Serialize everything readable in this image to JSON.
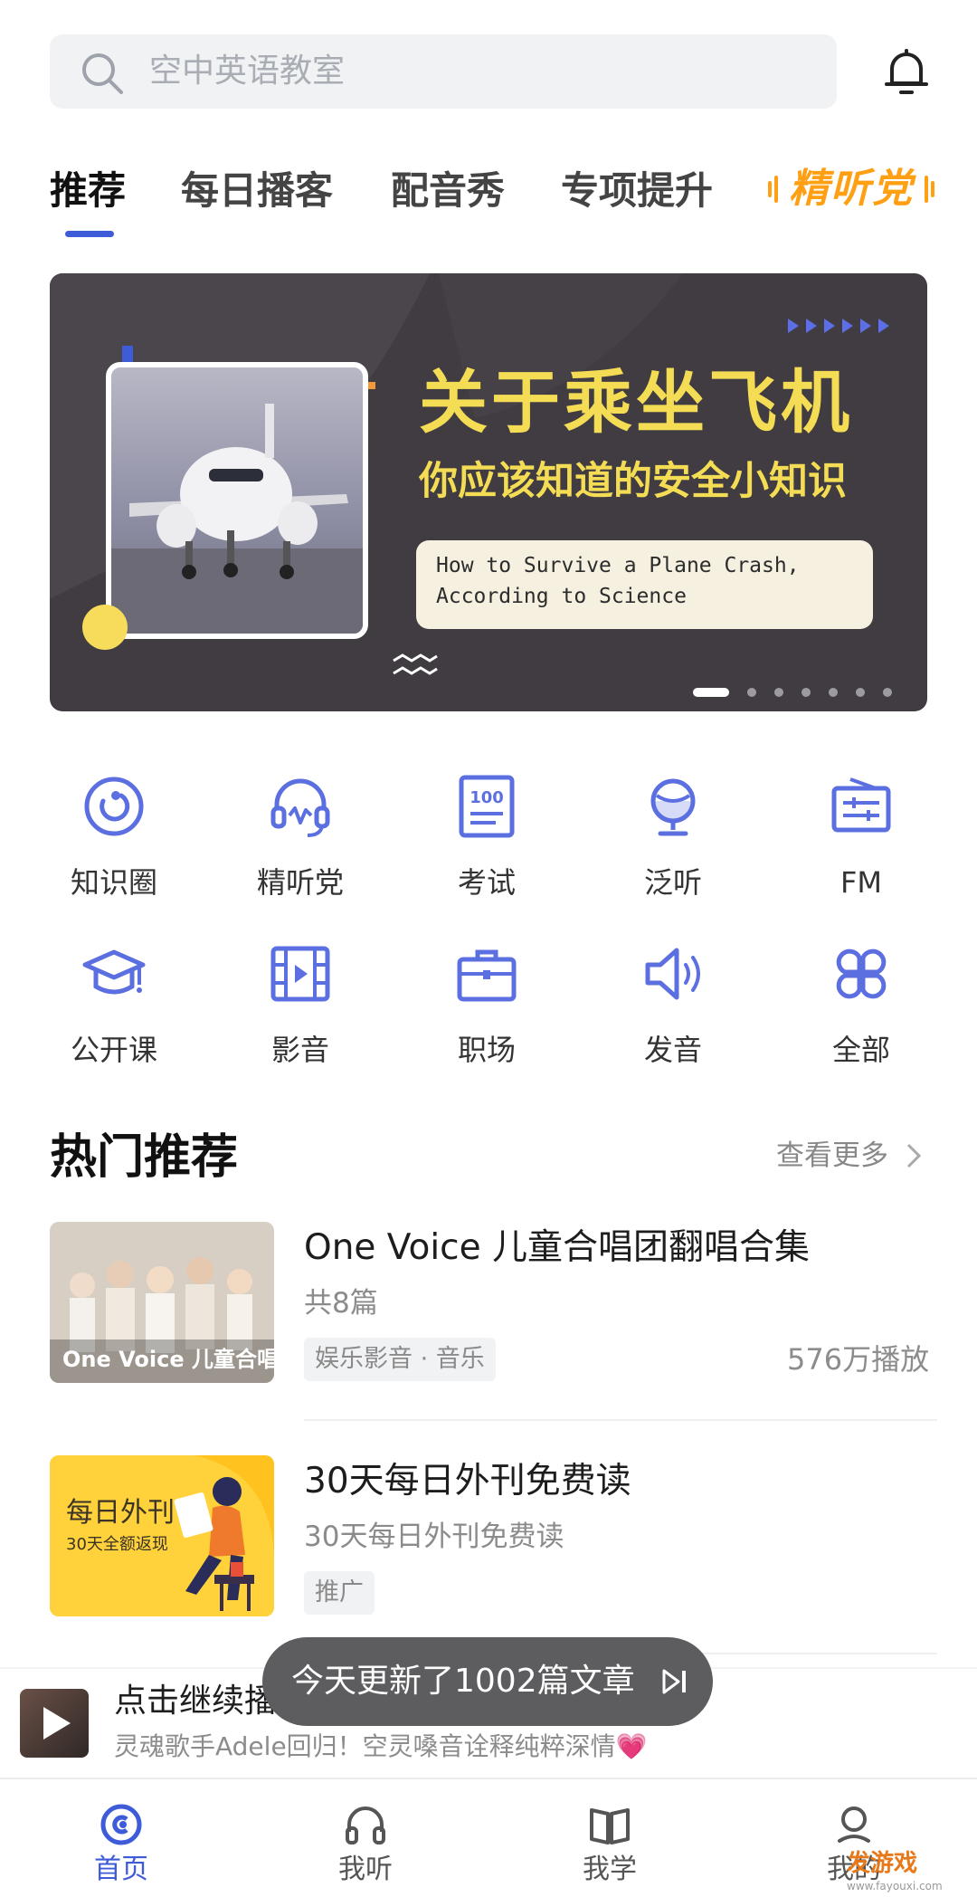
{
  "colors": {
    "accent": "#3e5bd8",
    "icon": "#5b6fe0",
    "banner_bg": "#403c42",
    "banner_title": "#f4dd54",
    "special_tab": "#ff9f14"
  },
  "search": {
    "placeholder": "空中英语教室",
    "icon": "search-icon",
    "bell_icon": "bell-icon"
  },
  "tabs": [
    {
      "label": "推荐",
      "active": true
    },
    {
      "label": "每日播客",
      "active": false
    },
    {
      "label": "配音秀",
      "active": false
    },
    {
      "label": "专项提升",
      "active": false
    },
    {
      "label": "精听党",
      "active": false
    }
  ],
  "banner": {
    "title": "关于乘坐飞机",
    "subtitle": "你应该知道的安全小知识",
    "card_line1": "How to Survive a Plane Crash,",
    "card_line2": "According to Science",
    "slides_total": 7,
    "slide_active": 1
  },
  "grid": [
    {
      "label": "知识圈",
      "icon": "ring-icon"
    },
    {
      "label": "精听党",
      "icon": "headset-icon"
    },
    {
      "label": "考试",
      "icon": "exam-100-icon"
    },
    {
      "label": "泛听",
      "icon": "globe-icon"
    },
    {
      "label": "FM",
      "icon": "radio-icon"
    },
    {
      "label": "公开课",
      "icon": "graduation-cap-icon"
    },
    {
      "label": "影音",
      "icon": "film-icon"
    },
    {
      "label": "职场",
      "icon": "briefcase-icon"
    },
    {
      "label": "发音",
      "icon": "speaker-icon"
    },
    {
      "label": "全部",
      "icon": "grid-four-icon"
    }
  ],
  "section": {
    "title": "热门推荐",
    "more": "查看更多"
  },
  "items": [
    {
      "title": "One Voice 儿童合唱团翻唱合集",
      "subtitle": "共8篇",
      "tag": "娱乐影音 · 音乐",
      "plays": "576万播放",
      "thumb_text": "One Voice 儿童合唱团"
    },
    {
      "title": "30天每日外刊免费读",
      "subtitle": "30天每日外刊免费读",
      "tag": "推广",
      "thumb_text1": "每日外刊",
      "thumb_text2": "30天全额返现"
    }
  ],
  "mini_player": {
    "title": "点击继续播",
    "subtitle": "灵魂歌手Adele回归！空灵嗓音诠释纯粹深情💗"
  },
  "toast": {
    "text": "今天更新了1002篇文章"
  },
  "bottom_nav": [
    {
      "label": "首页",
      "icon": "home-icon",
      "active": true
    },
    {
      "label": "我听",
      "icon": "headphones-icon",
      "active": false
    },
    {
      "label": "我学",
      "icon": "book-icon",
      "active": false
    },
    {
      "label": "我的",
      "icon": "profile-icon",
      "active": false
    }
  ],
  "watermark": {
    "brand": "发游戏",
    "url": "www.fayouxi.com"
  }
}
